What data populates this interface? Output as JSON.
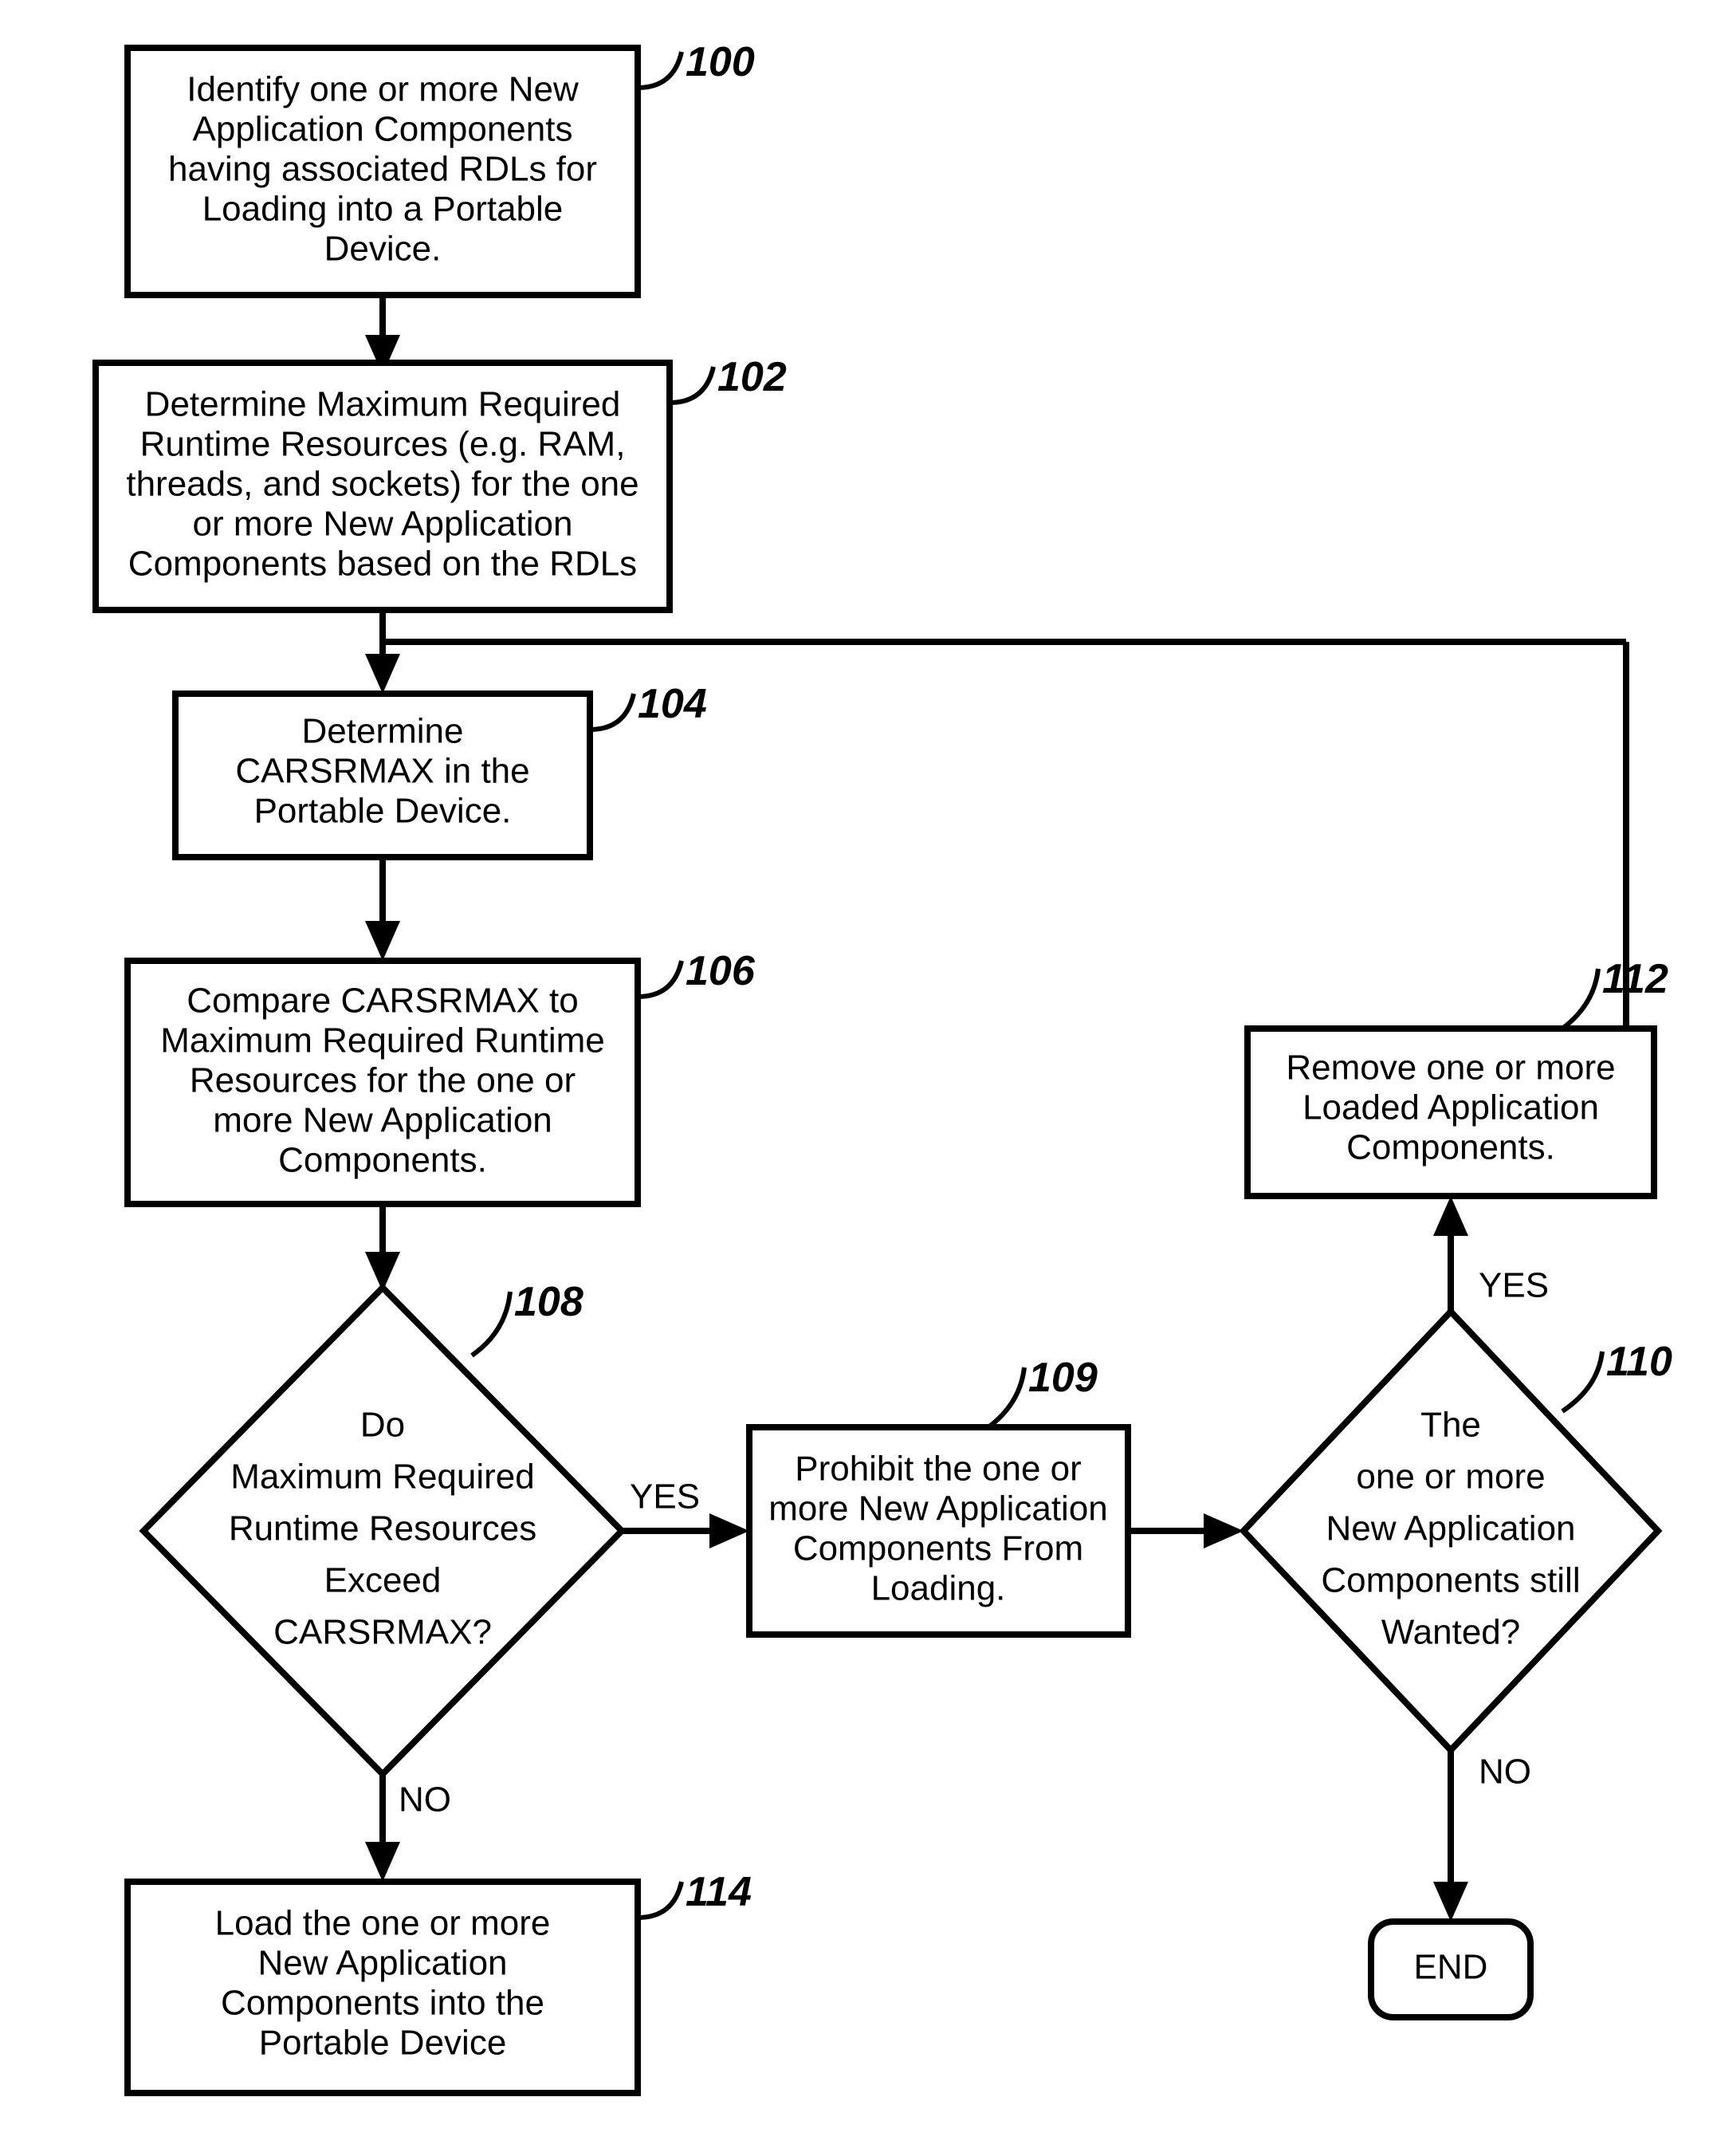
{
  "boxes": {
    "b100": {
      "ref": "100",
      "lines": [
        "Identify one or more New",
        "Application Components",
        "having associated RDLs for",
        "Loading into a Portable",
        "Device."
      ]
    },
    "b102": {
      "ref": "102",
      "lines": [
        "Determine Maximum Required",
        "Runtime Resources (e.g. RAM,",
        "threads, and sockets) for the one",
        "or more New Application",
        "Components based on the RDLs"
      ]
    },
    "b104": {
      "ref": "104",
      "lines": [
        "Determine",
        "CARSRMAX in the",
        "Portable Device."
      ]
    },
    "b106": {
      "ref": "106",
      "lines": [
        "Compare CARSRMAX to",
        "Maximum Required Runtime",
        "Resources for the one or",
        "more New Application",
        "Components."
      ]
    },
    "b108": {
      "ref": "108",
      "lines": [
        "Do",
        "Maximum Required",
        "Runtime Resources",
        "Exceed",
        "CARSRMAX?"
      ]
    },
    "b109": {
      "ref": "109",
      "lines": [
        "Prohibit the one or",
        "more New Application",
        "Components From",
        "Loading."
      ]
    },
    "b110": {
      "ref": "110",
      "lines": [
        "The",
        "one or more",
        "New Application",
        "Components still",
        "Wanted?"
      ]
    },
    "b112": {
      "ref": "112",
      "lines": [
        "Remove one or more",
        "Loaded Application",
        "Components."
      ]
    },
    "b114": {
      "ref": "114",
      "lines": [
        "Load the one or more",
        "New Application",
        "Components into the",
        "Portable Device"
      ]
    },
    "end": {
      "lines": [
        "END"
      ]
    }
  },
  "labels": {
    "yes": "YES",
    "no": "NO"
  }
}
